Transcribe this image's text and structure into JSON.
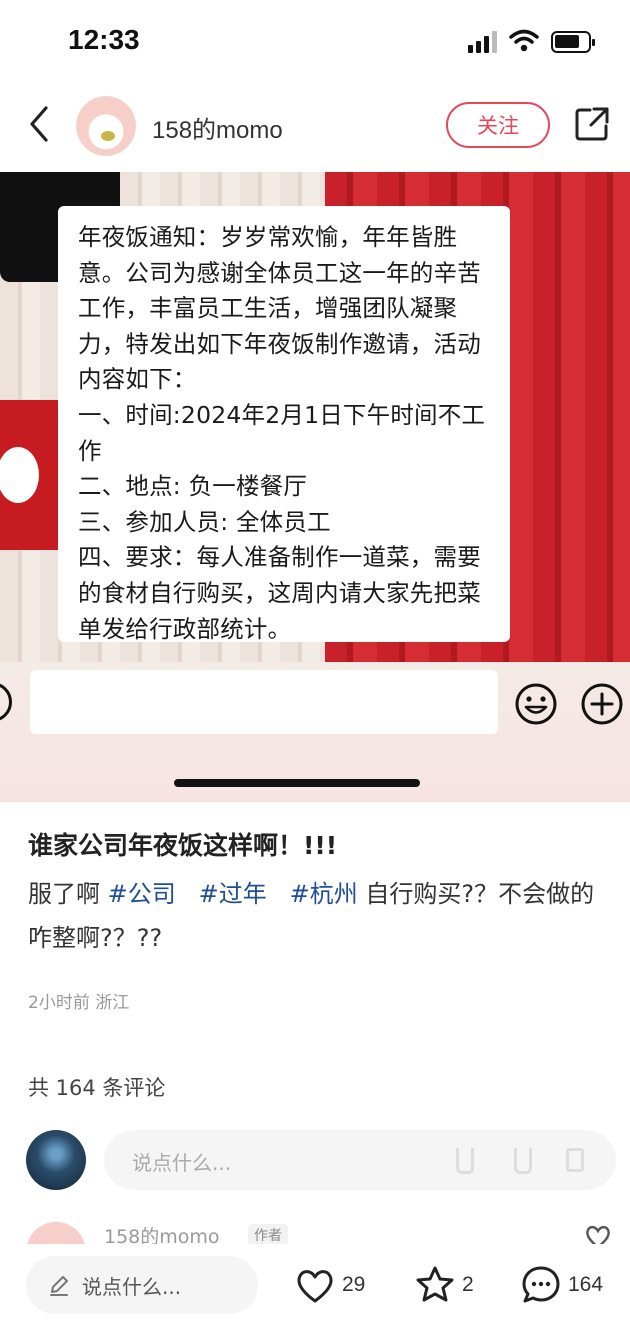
{
  "status_bar": {
    "time": "12:33",
    "icons": [
      "signal-icon",
      "wifi-icon",
      "battery-icon"
    ]
  },
  "header": {
    "username": "158的momo",
    "follow_label": "关注",
    "icons": [
      "back-icon",
      "share-icon"
    ]
  },
  "post_image": {
    "notice_text": "年夜饭通知：岁岁常欢愉，年年皆胜意。公司为感谢全体员工这一年的辛苦工作，丰富员工生活，增强团队凝聚力，特发出如下年夜饭制作邀请，活动内容如下：\n一、时间:2024年2月1日下午时间不工作\n二、地点: 负一楼餐厅\n三、参加人员: 全体员工\n四、要求：每人准备制作一道菜，需要的食材自行购买，这周内请大家先把菜单发给行政部统计。",
    "colors": {
      "card": "#ffffff",
      "sweater_red": "#c9212a",
      "sweater_cream": "#ede3dc"
    }
  },
  "post": {
    "title": "谁家公司年夜饭这样啊！!!!",
    "text_prefix": "服了啊 ",
    "tags": [
      "#公司",
      "#过年",
      "#杭州"
    ],
    "text_suffix": " 自行购买?？不会做的咋整啊?？??",
    "meta": "2小时前 浙江"
  },
  "comments": {
    "count_label": "共 164 条评论",
    "input_placeholder": "说点什么...",
    "first": {
      "name": "158的momo",
      "badge": "作者"
    }
  },
  "bottom_bar": {
    "input_placeholder": "说点什么...",
    "likes": "29",
    "stars": "2",
    "comments": "164"
  },
  "accent_color": "#e8475a",
  "tag_color": "#1f4e96"
}
